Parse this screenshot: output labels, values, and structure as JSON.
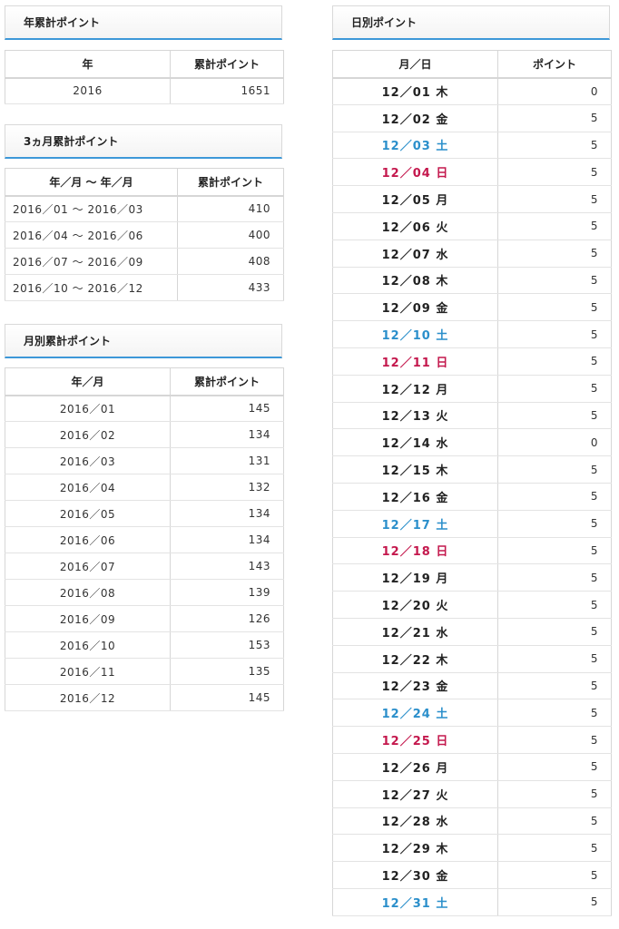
{
  "yearly": {
    "title": "年累計ポイント",
    "headers": [
      "年",
      "累計ポイント"
    ],
    "rows": [
      {
        "period": "2016",
        "points": "1651"
      }
    ]
  },
  "quarterly": {
    "title": "3ヵ月累計ポイント",
    "headers": [
      "年／月 ～ 年／月",
      "累計ポイント"
    ],
    "rows": [
      {
        "period": "2016／01 ～ 2016／03",
        "points": "410"
      },
      {
        "period": "2016／04 ～ 2016／06",
        "points": "400"
      },
      {
        "period": "2016／07 ～ 2016／09",
        "points": "408"
      },
      {
        "period": "2016／10 ～ 2016／12",
        "points": "433"
      }
    ]
  },
  "monthly": {
    "title": "月別累計ポイント",
    "headers": [
      "年／月",
      "累計ポイント"
    ],
    "rows": [
      {
        "period": "2016／01",
        "points": "145"
      },
      {
        "period": "2016／02",
        "points": "134"
      },
      {
        "period": "2016／03",
        "points": "131"
      },
      {
        "period": "2016／04",
        "points": "132"
      },
      {
        "period": "2016／05",
        "points": "134"
      },
      {
        "period": "2016／06",
        "points": "134"
      },
      {
        "period": "2016／07",
        "points": "143"
      },
      {
        "period": "2016／08",
        "points": "139"
      },
      {
        "period": "2016／09",
        "points": "126"
      },
      {
        "period": "2016／10",
        "points": "153"
      },
      {
        "period": "2016／11",
        "points": "135"
      },
      {
        "period": "2016／12",
        "points": "145"
      }
    ]
  },
  "daily": {
    "title": "日別ポイント",
    "headers": [
      "月／日",
      "ポイント"
    ],
    "colors": {
      "saturday": "#2b8fcb",
      "sunday": "#c4184d",
      "weekday": "#222222"
    },
    "rows": [
      {
        "date": "12／01 木",
        "points": "0",
        "kind": "wk"
      },
      {
        "date": "12／02 金",
        "points": "5",
        "kind": "wk"
      },
      {
        "date": "12／03 土",
        "points": "5",
        "kind": "sat"
      },
      {
        "date": "12／04 日",
        "points": "5",
        "kind": "sun"
      },
      {
        "date": "12／05 月",
        "points": "5",
        "kind": "wk"
      },
      {
        "date": "12／06 火",
        "points": "5",
        "kind": "wk"
      },
      {
        "date": "12／07 水",
        "points": "5",
        "kind": "wk"
      },
      {
        "date": "12／08 木",
        "points": "5",
        "kind": "wk"
      },
      {
        "date": "12／09 金",
        "points": "5",
        "kind": "wk"
      },
      {
        "date": "12／10 土",
        "points": "5",
        "kind": "sat"
      },
      {
        "date": "12／11 日",
        "points": "5",
        "kind": "sun"
      },
      {
        "date": "12／12 月",
        "points": "5",
        "kind": "wk"
      },
      {
        "date": "12／13 火",
        "points": "5",
        "kind": "wk"
      },
      {
        "date": "12／14 水",
        "points": "0",
        "kind": "wk"
      },
      {
        "date": "12／15 木",
        "points": "5",
        "kind": "wk"
      },
      {
        "date": "12／16 金",
        "points": "5",
        "kind": "wk"
      },
      {
        "date": "12／17 土",
        "points": "5",
        "kind": "sat"
      },
      {
        "date": "12／18 日",
        "points": "5",
        "kind": "sun"
      },
      {
        "date": "12／19 月",
        "points": "5",
        "kind": "wk"
      },
      {
        "date": "12／20 火",
        "points": "5",
        "kind": "wk"
      },
      {
        "date": "12／21 水",
        "points": "5",
        "kind": "wk"
      },
      {
        "date": "12／22 木",
        "points": "5",
        "kind": "wk"
      },
      {
        "date": "12／23 金",
        "points": "5",
        "kind": "wk"
      },
      {
        "date": "12／24 土",
        "points": "5",
        "kind": "sat"
      },
      {
        "date": "12／25 日",
        "points": "5",
        "kind": "sun"
      },
      {
        "date": "12／26 月",
        "points": "5",
        "kind": "wk"
      },
      {
        "date": "12／27 火",
        "points": "5",
        "kind": "wk"
      },
      {
        "date": "12／28 水",
        "points": "5",
        "kind": "wk"
      },
      {
        "date": "12／29 木",
        "points": "5",
        "kind": "wk"
      },
      {
        "date": "12／30 金",
        "points": "5",
        "kind": "wk"
      },
      {
        "date": "12／31 土",
        "points": "5",
        "kind": "sat"
      }
    ]
  }
}
